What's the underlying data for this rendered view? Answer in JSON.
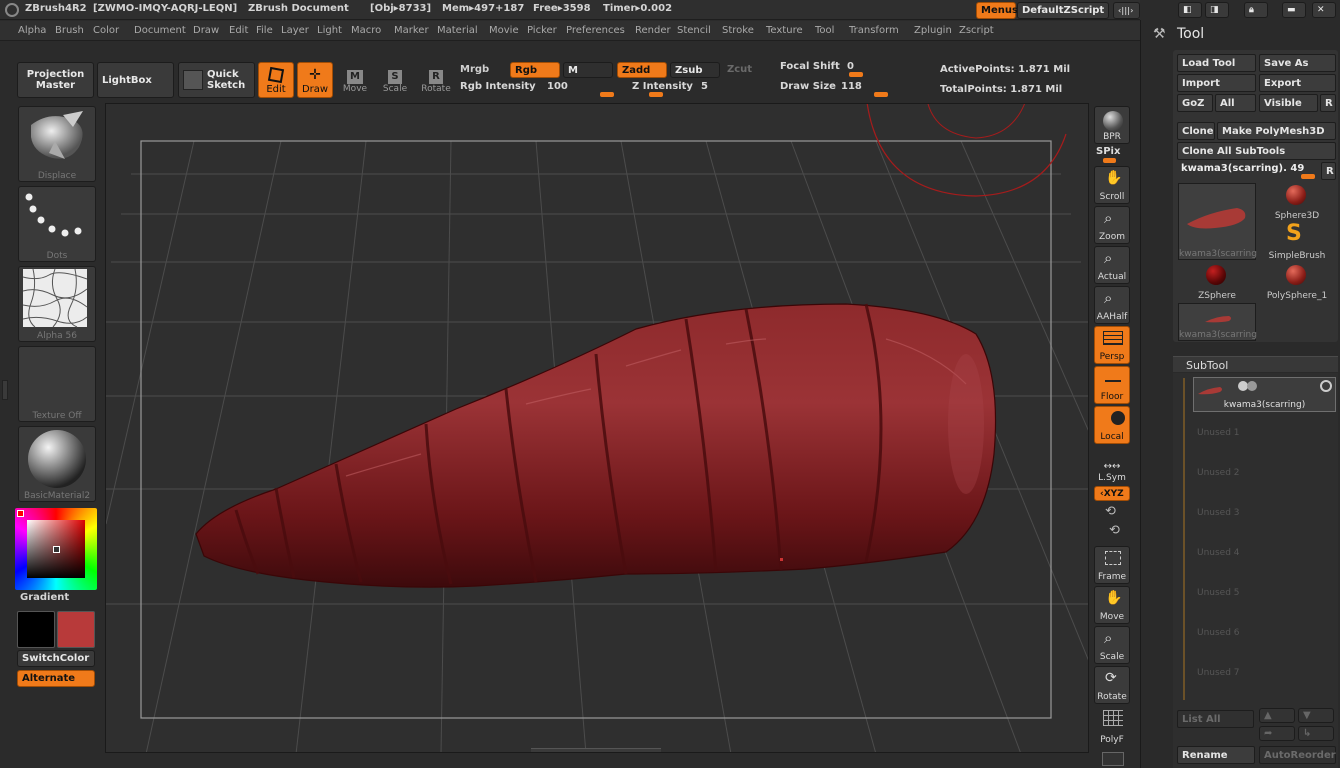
{
  "titlebar": {
    "app": "ZBrush4R2",
    "serial": "[ZWMO-IMQY-AQRJ-LEQN]",
    "document": "ZBrush Document",
    "obj": "[Obj▸8733]",
    "mem": "Mem▸497+187",
    "free": "Free▸3598",
    "timer": "Timer▸0.002",
    "menus_btn": "Menus",
    "zscript_btn": "DefaultZScript"
  },
  "menubar": [
    "Alpha",
    "Brush",
    "Color",
    "Document",
    "Draw",
    "Edit",
    "File",
    "Layer",
    "Light",
    "Macro",
    "Marker",
    "Material",
    "Movie",
    "Picker",
    "Preferences",
    "Render",
    "Stencil",
    "Stroke",
    "Texture",
    "Tool",
    "Transform",
    "Zplugin",
    "Zscript"
  ],
  "toolbar": {
    "projection_master_1": "Projection",
    "projection_master_2": "Master",
    "lightbox": "LightBox",
    "quick_sketch_1": "Quick",
    "quick_sketch_2": "Sketch",
    "edit": "Edit",
    "draw": "Draw",
    "move": "Move",
    "scale": "Scale",
    "rotate": "Rotate",
    "mrgb": "Mrgb",
    "rgb": "Rgb",
    "m": "M",
    "zadd": "Zadd",
    "zsub": "Zsub",
    "zcut": "Zcut",
    "rgb_intensity_label": "Rgb Intensity",
    "rgb_intensity_value": "100",
    "z_intensity_label": "Z Intensity",
    "z_intensity_value": "5",
    "focal_shift_label": "Focal Shift",
    "focal_shift_value": "0",
    "draw_size_label": "Draw Size",
    "draw_size_value": "118",
    "active_points": "ActivePoints: 1.871  Mil",
    "total_points": "TotalPoints: 1.871  Mil"
  },
  "leftpanel": {
    "displace": "Displace",
    "dots": "Dots",
    "alpha": "Alpha  56",
    "texture": "Texture  Off",
    "material": "BasicMaterial2",
    "gradient": "Gradient",
    "switch_color": "SwitchColor",
    "alternate": "Alternate",
    "main_color": "#000000",
    "secondary_color": "#b83a3a"
  },
  "rightshelf": {
    "bpr": "BPR",
    "spix": "SPix",
    "scroll": "Scroll",
    "zoom": "Zoom",
    "actual": "Actual",
    "aahalf": "AAHalf",
    "persp": "Persp",
    "floor": "Floor",
    "local": "Local",
    "lsym": "L.Sym",
    "xyz": "‹XYZ",
    "frame": "Frame",
    "move": "Move",
    "scale": "Scale",
    "rotate": "Rotate",
    "polyf": "PolyF"
  },
  "toolpanel": {
    "title": "Tool",
    "load_tool": "Load Tool",
    "save_as": "Save As",
    "import": "Import",
    "export": "Export",
    "goz": "GoZ",
    "all": "All",
    "visible": "Visible",
    "r": "R",
    "clone": "Clone",
    "make_polymesh": "Make PolyMesh3D",
    "clone_all": "Clone All SubTools",
    "current_tool": "kwama3(scarring). 49",
    "current_tool_thumb_label": "kwama3(scarring",
    "sphere3d": "Sphere3D",
    "simplebrush": "SimpleBrush",
    "zsphere": "ZSphere",
    "polysphere": "PolySphere_1",
    "second_thumb_label": "kwama3(scarring",
    "subtool_header": "SubTool",
    "subtool_item": "kwama3(scarring)",
    "unused": [
      "Unused  1",
      "Unused  2",
      "Unused  3",
      "Unused  4",
      "Unused  5",
      "Unused  6",
      "Unused  7"
    ],
    "list_all": "List  All",
    "rename": "Rename",
    "autoreorder": "AutoReorder"
  },
  "colors": {
    "accent": "#f07a1a",
    "mesh": "#7a1d1f",
    "background": "#2b2b2b"
  }
}
